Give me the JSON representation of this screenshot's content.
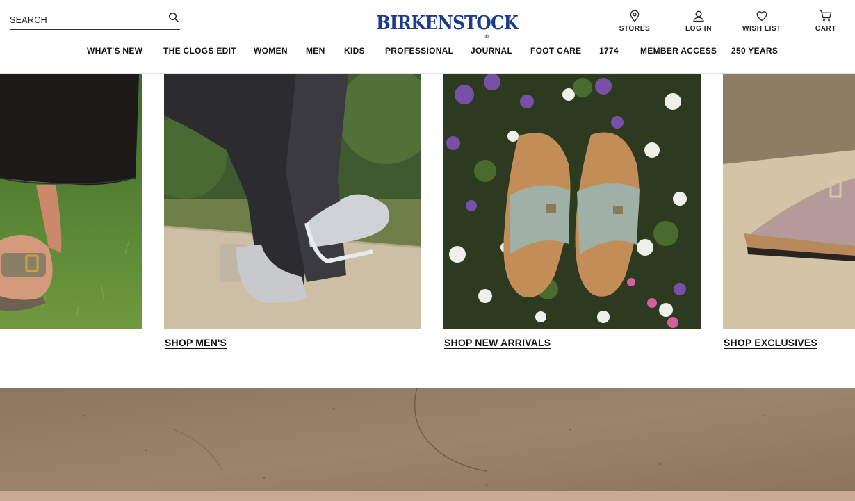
{
  "header": {
    "search": {
      "placeholder": "SEARCH",
      "value": "",
      "icon": "search-icon"
    },
    "logo": {
      "text": "BIRKENSTOCK",
      "mark": "®"
    },
    "utility": [
      {
        "label": "STORES",
        "icon": "location-pin-icon"
      },
      {
        "label": "LOG IN",
        "icon": "user-icon"
      },
      {
        "label": "WISH LIST",
        "icon": "heart-icon"
      },
      {
        "label": "CART",
        "icon": "cart-icon"
      }
    ]
  },
  "nav": {
    "items": [
      "WHAT'S NEW",
      "THE CLOGS EDIT",
      "WOMEN",
      "MEN",
      "KIDS",
      "PROFESSIONAL",
      "JOURNAL",
      "FOOT CARE",
      "1774",
      "MEMBER ACCESS",
      "250 YEARS"
    ]
  },
  "tiles": [
    {
      "cta": ""
    },
    {
      "cta": "SHOP MEN'S"
    },
    {
      "cta": "SHOP NEW ARRIVALS"
    },
    {
      "cta": "SHOP EXCLUSIVES"
    }
  ],
  "colors": {
    "brand": "#1b3b8f",
    "text": "#111111",
    "divider": "#e2e2e2"
  }
}
